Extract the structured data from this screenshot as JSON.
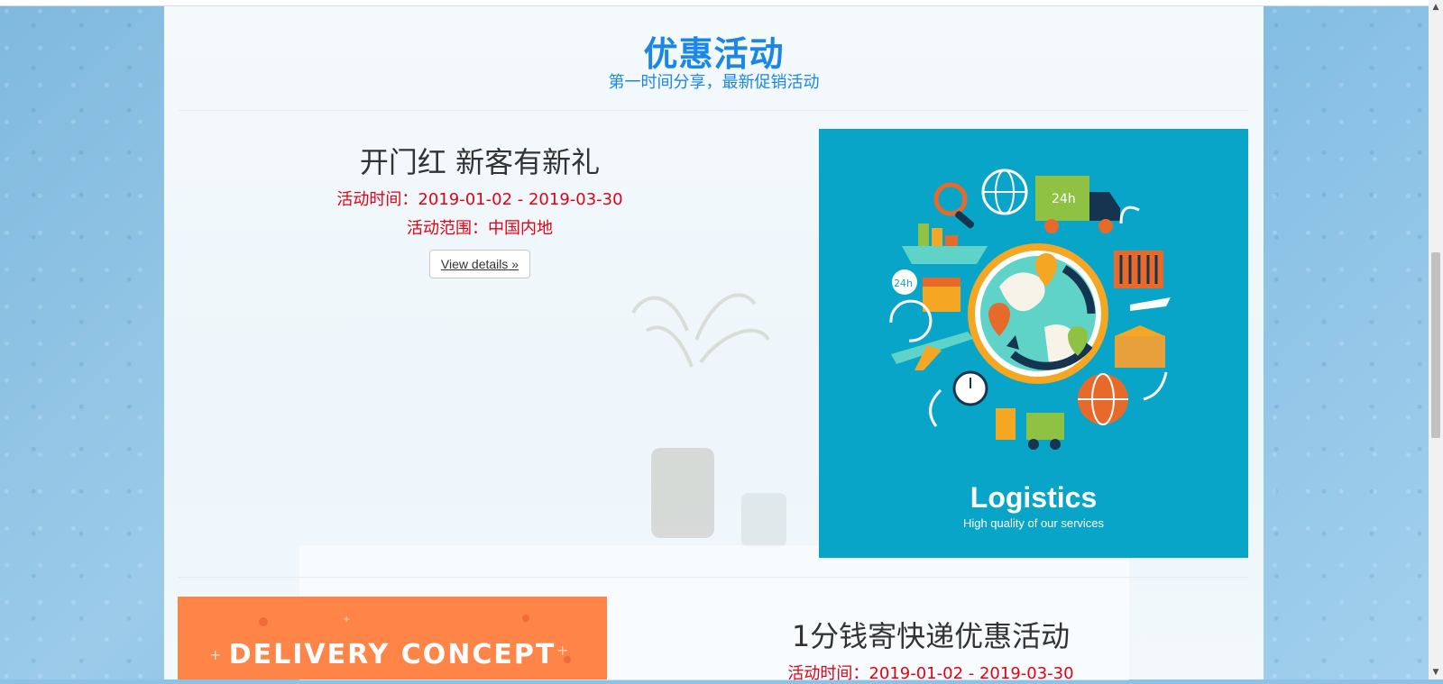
{
  "header": {
    "title": "优惠活动",
    "subtitle": "第一时间分享，最新促销活动"
  },
  "promos": [
    {
      "title": "开门红 新客有新礼",
      "time": "活动时间：2019-01-02 - 2019-03-30",
      "scope": "活动范围：中国内地",
      "button": "View details »",
      "image": {
        "title": "Logistics",
        "caption": "High quality of our services",
        "badge": "24h",
        "badge2": "24h"
      }
    },
    {
      "title": "1分钱寄快递优惠活动",
      "time": "活动时间：2019-01-02 - 2019-03-30",
      "image": {
        "title": "DELIVERY CONCEPT"
      }
    }
  ],
  "colors": {
    "accent": "#1a86e8",
    "highlight": "#e60012",
    "logistics_bg": "#08a5c9",
    "delivery_bg": "#ff8448"
  }
}
